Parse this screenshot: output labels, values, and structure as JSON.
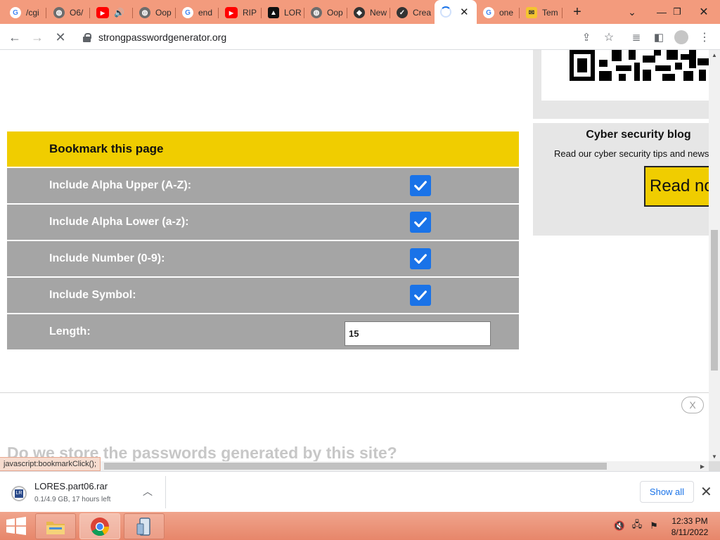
{
  "browser": {
    "tabs": [
      {
        "label": "/cgi",
        "favicon": "google-icon"
      },
      {
        "label": "O6/",
        "favicon": "globe-icon"
      },
      {
        "label": "",
        "favicon": "youtube-icon",
        "audio": true
      },
      {
        "label": "Oop",
        "favicon": "globe-icon"
      },
      {
        "label": "end",
        "favicon": "google-icon"
      },
      {
        "label": "RIP",
        "favicon": "youtube-icon"
      },
      {
        "label": "LOR",
        "favicon": "lores-icon"
      },
      {
        "label": "Oop",
        "favicon": "globe-icon"
      },
      {
        "label": "New",
        "favicon": "shield-icon"
      },
      {
        "label": "Crea",
        "favicon": "check-circle-icon"
      },
      {
        "label": "",
        "favicon": "loading-spinner",
        "active": true
      },
      {
        "label": "one",
        "favicon": "google-icon"
      },
      {
        "label": "Tem",
        "favicon": "mail-icon"
      }
    ],
    "url": "strongpasswordgenerator.org",
    "status_url": "javascript:bookmarkClick();"
  },
  "page": {
    "form": {
      "header": "Bookmark this page",
      "rows": [
        {
          "label": "Include Alpha Upper (A-Z):",
          "checked": true
        },
        {
          "label": "Include Alpha Lower (a-z):",
          "checked": true
        },
        {
          "label": "Include Number (0-9):",
          "checked": true
        },
        {
          "label": "Include Symbol:",
          "checked": true
        }
      ],
      "length_label": "Length:",
      "length_value": "15"
    },
    "sidebar": {
      "blog_title": "Cyber security blog",
      "blog_text": "Read our cyber security tips and news",
      "read_button": "Read now"
    },
    "ad_close": "X",
    "faq_heading": "Do we store the passwords generated by this site?"
  },
  "downloads": {
    "file_name": "LORES.part06.rar",
    "status": "0.1/4.9 GB, 17 hours left",
    "show_all": "Show all"
  },
  "taskbar": {
    "time": "12:33 PM",
    "date": "8/11/2022"
  },
  "colors": {
    "accent_yellow": "#f0cd00",
    "form_gray": "#a5a5a5",
    "checkbox_blue": "#1a73e8",
    "chrome_frame": "#f39b7d"
  }
}
